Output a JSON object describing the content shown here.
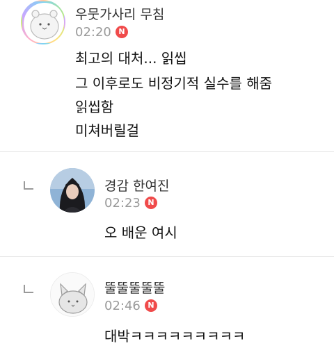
{
  "comments": [
    {
      "nickname": "우뭇가사리 무침",
      "time": "02:20",
      "badge": "N",
      "lines": [
        "최고의 대처... 읽씹",
        "그 이후로도 비정기적 실수를 해줌",
        "읽씹함",
        "미쳐버릴걸"
      ],
      "avatar_icon": "hamster-avatar-icon"
    },
    {
      "nickname": "경감 한여진",
      "time": "02:23",
      "badge": "N",
      "lines": [
        "오 배운 여시"
      ],
      "avatar_icon": "photo-avatar-icon"
    },
    {
      "nickname": "뚤뚤뚤뚤뚤",
      "time": "02:46",
      "badge": "N",
      "lines": [
        "대박ㅋㅋㅋㅋㅋㅋㅋㅋㅋ"
      ],
      "avatar_icon": "cat-avatar-icon"
    }
  ],
  "colors": {
    "badge": "#f04b4b",
    "meta": "#9a9a9a",
    "divider": "#e6e6e6"
  }
}
